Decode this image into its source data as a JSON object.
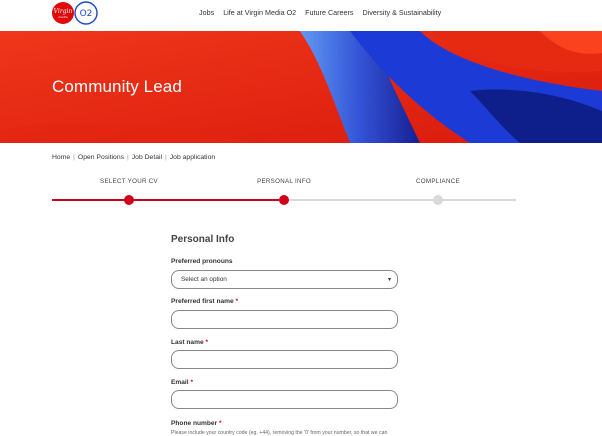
{
  "header": {
    "logo_virgin": "Virgin",
    "logo_sub": "media",
    "logo_o2": "O2",
    "nav": [
      "Jobs",
      "Life at Virgin Media O2",
      "Future Careers",
      "Diversity & Sustainability"
    ]
  },
  "hero": {
    "title": "Community Lead"
  },
  "breadcrumb": [
    "Home",
    "Open Positions",
    "Job Detail",
    "Job application"
  ],
  "breadcrumb_sep": "|",
  "stepper": {
    "steps": [
      {
        "label": "SELECT YOUR CV",
        "state": "complete"
      },
      {
        "label": "PERSONAL INFO",
        "state": "current"
      },
      {
        "label": "COMPLIANCE",
        "state": "pending"
      }
    ],
    "progress": 0.5,
    "active_color": "#d0021b",
    "inactive_color": "#d9d9d9"
  },
  "form": {
    "title": "Personal Info",
    "pronouns": {
      "label": "Preferred pronouns",
      "value": "Select an option",
      "caret": "▾"
    },
    "first_name": {
      "label": "Preferred first name",
      "required_mark": "*",
      "value": ""
    },
    "last_name": {
      "label": "Last name",
      "required_mark": "*",
      "value": ""
    },
    "email": {
      "label": "Email",
      "required_mark": "*",
      "value": ""
    },
    "phone": {
      "label": "Phone number",
      "required_mark": "*",
      "hint": "Please include your country code (eg. +44), removing the '0' from your number, so that we can"
    }
  },
  "colors": {
    "brand_red": "#e8250f",
    "brand_blue": "#1f3fd0",
    "required": "#d0021b"
  }
}
